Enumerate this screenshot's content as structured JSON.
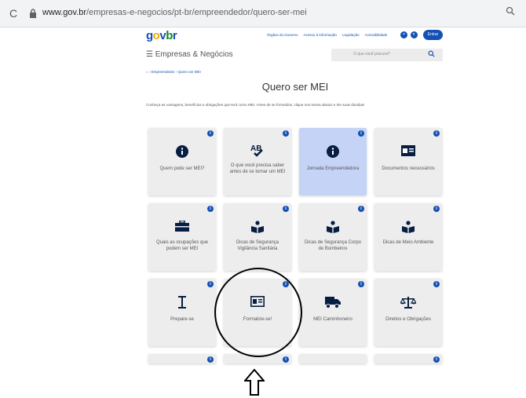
{
  "browser": {
    "reload": "C",
    "url_host": "www.gov.br",
    "url_path": "/empresas-e-negocios/pt-br/empreendedor/quero-ser-mei"
  },
  "header": {
    "logo": {
      "g": "g",
      "o": "o",
      "v": "v",
      "b": "b",
      "r": "r"
    },
    "links": [
      "Órgãos do Governo",
      "Acesso à Informação",
      "Legislação",
      "Acessibilidade"
    ],
    "entrar": "Entrar"
  },
  "nav": {
    "menu": "Empresas & Negócios",
    "search_placeholder": "O que você procura?",
    "breadcrumb_home": "Empreendedor",
    "breadcrumb_current": "Quero ser MEI"
  },
  "page": {
    "title": "Quero ser MEI",
    "intro": "Conheça as vantagens, benefícios e obrigações que terá como MEI. Antes de se formalizar, clique nos textos abaixo e tire suas dúvidas!"
  },
  "cards": [
    {
      "label": "Quem pode ser MEI?",
      "icon": "info-icon"
    },
    {
      "label": "O que você precisa saber antes de se tornar um MEI",
      "icon": "ab-check-icon"
    },
    {
      "label": "Jornada Empreendedora",
      "icon": "info-icon"
    },
    {
      "label": "Documentos necessários",
      "icon": "id-card-icon"
    },
    {
      "label": "Quais as ocupações que podem ser MEI",
      "icon": "briefcase-icon"
    },
    {
      "label": "Dicas de Segurança Vigilância Sanitária",
      "icon": "book-reader-icon"
    },
    {
      "label": "Dicas de Segurança Corpo de Bombeiros",
      "icon": "book-reader-icon"
    },
    {
      "label": "Dicas de Meio Ambiente",
      "icon": "book-reader-icon"
    },
    {
      "label": "Prepare-se",
      "icon": "i-cursor-icon"
    },
    {
      "label": "Formalize-se!",
      "icon": "id-card-icon"
    },
    {
      "label": "MEI Caminhoneiro",
      "icon": "truck-icon"
    },
    {
      "label": "Direitos e Obrigações",
      "icon": "balance-scale-icon"
    }
  ],
  "colors": {
    "brand_blue": "#1351b4",
    "card_bg": "#ededed",
    "card_active": "#c5d4f6"
  }
}
